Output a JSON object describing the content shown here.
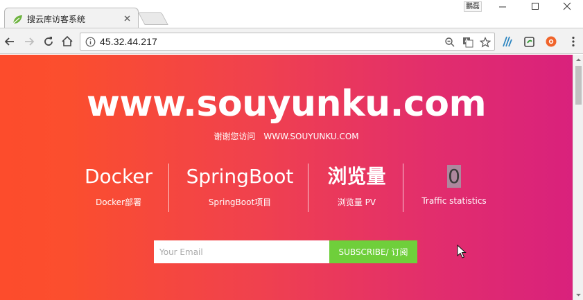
{
  "browser": {
    "tab": {
      "title": "搜云库访客系统",
      "favicon": "leaf-icon"
    },
    "profile_badge": "鵬磊",
    "window_controls": [
      "minimize-icon",
      "maximize-icon",
      "close-icon"
    ],
    "address": {
      "url": "45.32.44.217"
    },
    "omnibox_icons": [
      "info-icon",
      "zoom-icon",
      "translate-icon",
      "star-icon"
    ],
    "extensions": [
      "ext-a-icon",
      "ext-evernote-icon",
      "ext-orange-icon",
      "menu-icon"
    ]
  },
  "page": {
    "title": "www.souyunku.com",
    "subtitle": {
      "cn": "谢谢您访问",
      "en": "WWW.SOUYUNKU.COM"
    },
    "stats": [
      {
        "value": "Docker",
        "label": "Docker部署"
      },
      {
        "value": "SpringBoot",
        "label": "SpringBoot项目"
      },
      {
        "value": "浏览量",
        "label": "浏览量 PV"
      },
      {
        "value": "0",
        "label": "Traffic statistics"
      }
    ],
    "subscribe": {
      "placeholder": "Your Email",
      "button": "SUBSCRIBE/ 订阅"
    }
  },
  "colors": {
    "gradient_start": "#fd4c2c",
    "gradient_end": "#d9217c",
    "subscribe_button": "#6fcf3b"
  }
}
